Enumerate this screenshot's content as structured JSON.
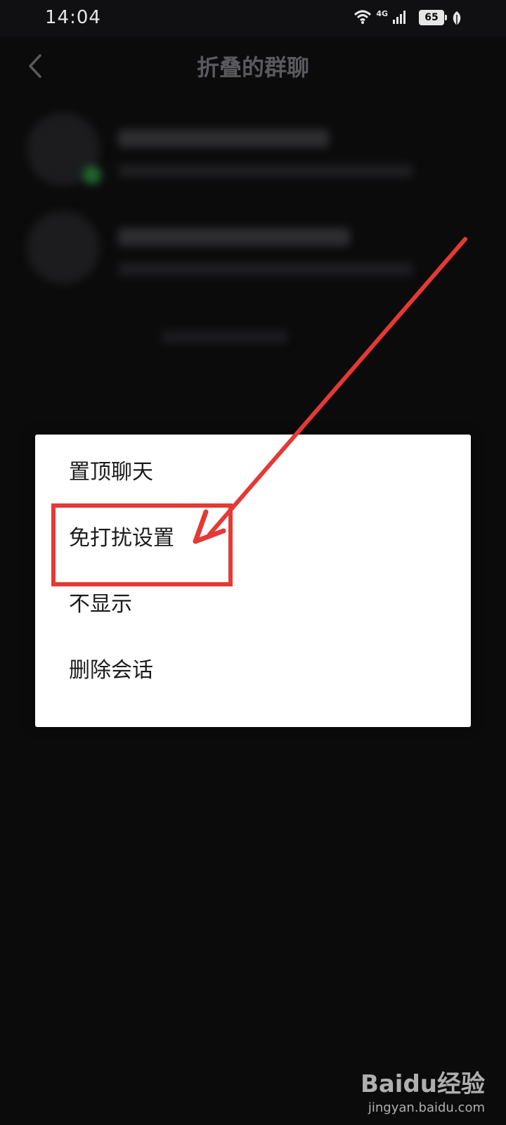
{
  "status_bar": {
    "time": "14:04",
    "network": "4G",
    "battery": "65",
    "icons": [
      "wifi-icon",
      "signal-icon",
      "battery-icon",
      "leaf-icon"
    ]
  },
  "header": {
    "title": "折叠的群聊",
    "back_icon": "chevron-left-icon"
  },
  "context_menu": {
    "items": [
      {
        "label": "置顶聊天"
      },
      {
        "label": "免打扰设置"
      },
      {
        "label": "不显示"
      },
      {
        "label": "删除会话"
      }
    ]
  },
  "annotation": {
    "highlight_color": "#e53935",
    "highlighted_item": "免打扰设置"
  },
  "watermark": {
    "brand": "Baidu经验",
    "url": "jingyan.baidu.com"
  },
  "colors": {
    "background": "#0b0b0c",
    "menu_background": "#ffffff",
    "menu_text": "#1b1b1b",
    "title_text": "#5a5a5e"
  }
}
